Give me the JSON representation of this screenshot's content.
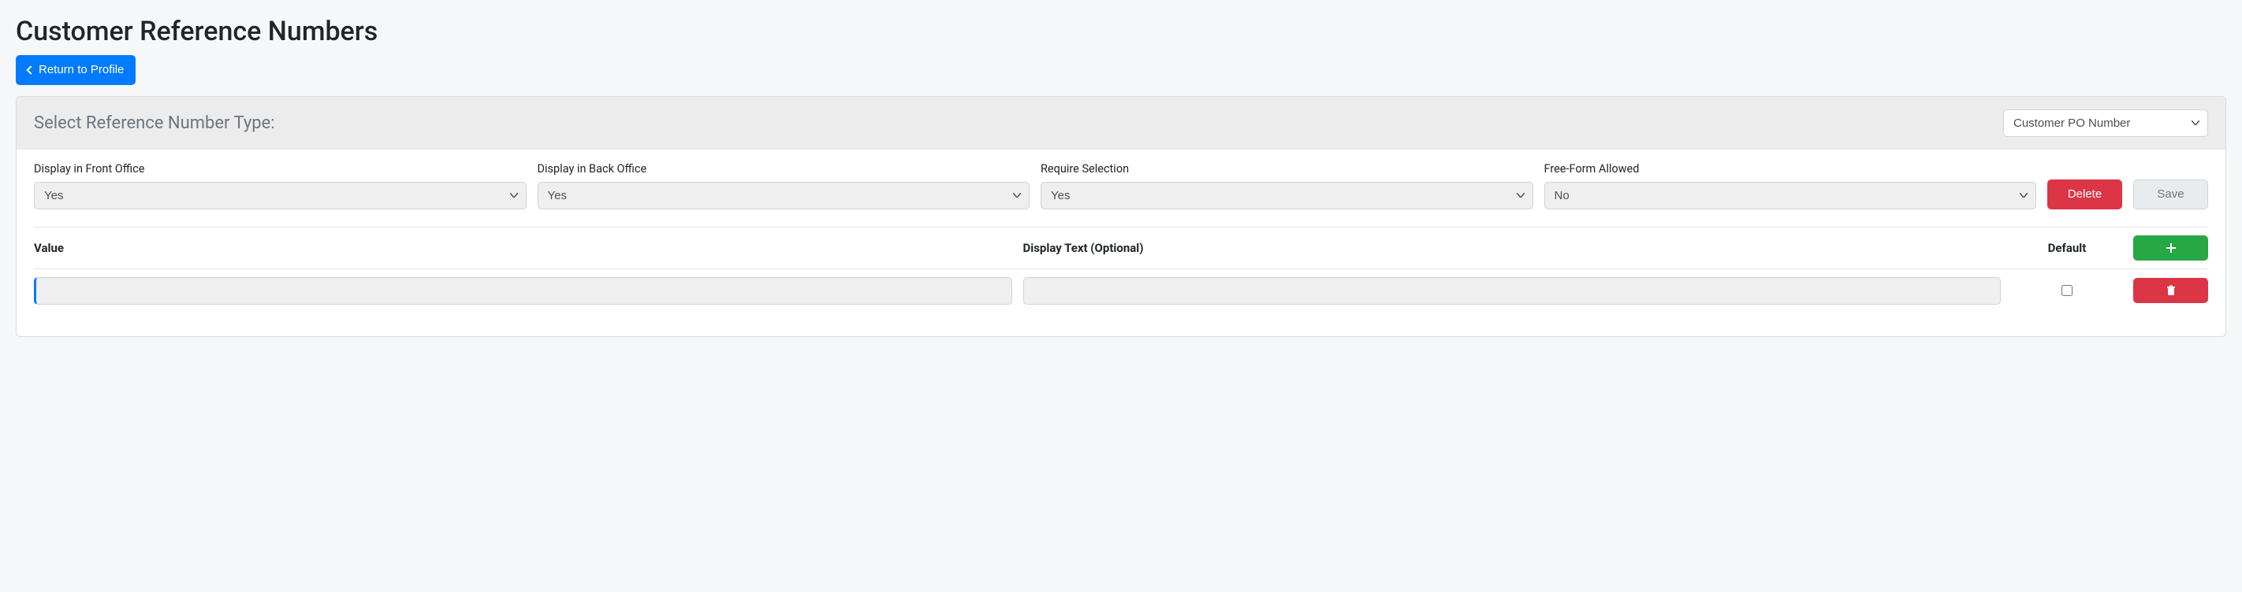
{
  "page": {
    "title": "Customer Reference Numbers",
    "return_label": "Return to Profile"
  },
  "panel": {
    "header_title": "Select Reference Number Type:",
    "type_selected": "Customer PO Number"
  },
  "options": {
    "front": {
      "label": "Display in Front Office",
      "value": "Yes"
    },
    "back": {
      "label": "Display in Back Office",
      "value": "Yes"
    },
    "require": {
      "label": "Require Selection",
      "value": "Yes"
    },
    "freeform": {
      "label": "Free-Form Allowed",
      "value": "No"
    }
  },
  "buttons": {
    "delete": "Delete",
    "save": "Save"
  },
  "table": {
    "col_value": "Value",
    "col_display": "Display Text (Optional)",
    "col_default": "Default"
  },
  "row": {
    "value": "",
    "display_text": "",
    "default_checked": false
  }
}
